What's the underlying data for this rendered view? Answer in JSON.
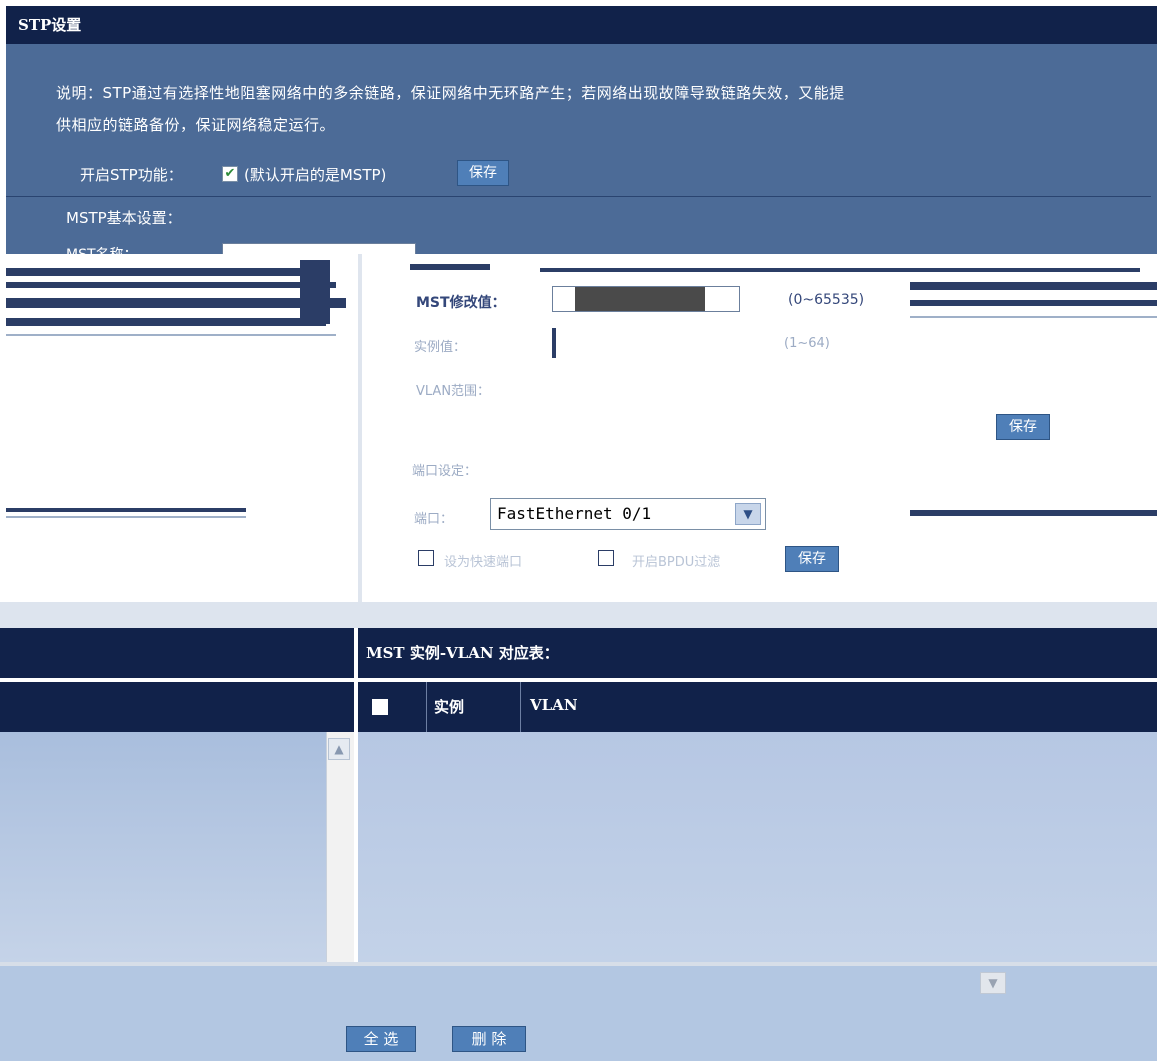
{
  "header": {
    "title": "STP设置"
  },
  "description": {
    "line1": "说明：STP通过有选择性地阻塞网络中的多余链路，保证网络中无环路产生；若网络出现故障导致链路失效，又能提",
    "line2": "供相应的链路备份，保证网络稳定运行。"
  },
  "stp": {
    "enable_label": "开启STP功能：",
    "enable_checked": true,
    "default_note": "(默认开启的是MSTP)",
    "save_label": "保存"
  },
  "mstp_basic": {
    "section_label": "MSTP基本设置：",
    "name_label": "MST名称："
  },
  "mst_instance": {
    "revision_label": "MST修改值：",
    "revision_range": "(0~65535)",
    "instance_label": "实例值：",
    "instance_range": "(1~64)",
    "vlan_label": "VLAN范围：",
    "save_label": "保存"
  },
  "port_settings": {
    "section_label": "端口设定：",
    "port_label": "端口：",
    "port_selected": "FastEthernet 0/1",
    "edge_port_label": "设为快速端口",
    "bpdu_filter_label": "开启BPDU过滤",
    "save_label": "保存"
  },
  "mst_table": {
    "title": "MST 实例-VLAN 对应表：",
    "columns": [
      "实例",
      "VLAN"
    ]
  },
  "footer": {
    "select_all": "全 选",
    "delete": "删 除"
  },
  "colors": {
    "navy": "#11224a",
    "panel": "#4c6b97",
    "button": "#4f7fb8",
    "check": "#2e8b3a"
  }
}
